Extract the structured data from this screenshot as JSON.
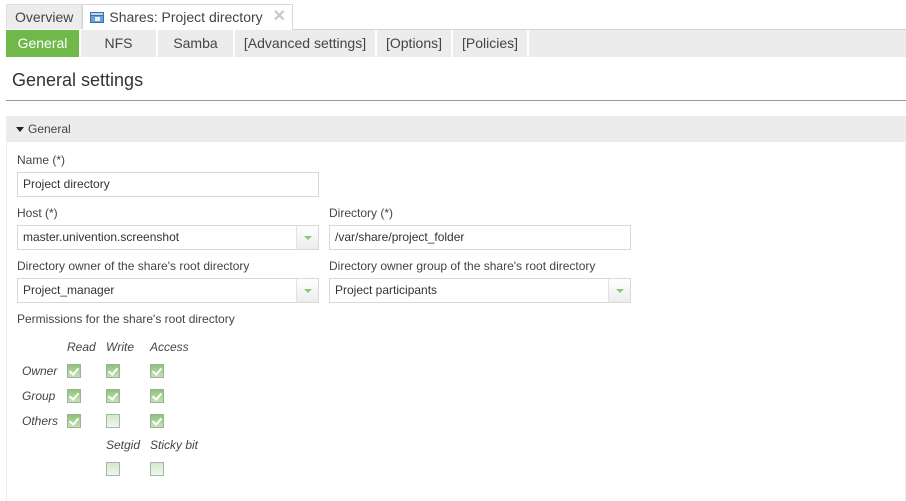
{
  "top_tabs": [
    {
      "label": "Overview",
      "active": false
    },
    {
      "label": "Shares: Project directory",
      "active": true,
      "icon": "share-icon",
      "closable": true
    }
  ],
  "sub_tabs": [
    {
      "label": "General",
      "active": true
    },
    {
      "label": "NFS",
      "active": false
    },
    {
      "label": "Samba",
      "active": false
    },
    {
      "label": "[Advanced settings]",
      "active": false
    },
    {
      "label": "[Options]",
      "active": false
    },
    {
      "label": "[Policies]",
      "active": false
    }
  ],
  "page_title": "General settings",
  "section": {
    "title": "General",
    "expanded": true
  },
  "form": {
    "name": {
      "label": "Name (*)",
      "value": "Project directory"
    },
    "host": {
      "label": "Host (*)",
      "value": "master.univention.screenshot"
    },
    "directory": {
      "label": "Directory (*)",
      "value": "/var/share/project_folder"
    },
    "owner": {
      "label": "Directory owner of the share's root directory",
      "value": "Project_manager"
    },
    "group": {
      "label": "Directory owner group of the share's root directory",
      "value": "Project participants"
    },
    "permissions": {
      "label": "Permissions for the share's root directory",
      "columns": [
        "Read",
        "Write",
        "Access"
      ],
      "rows": [
        {
          "label": "Owner",
          "read": true,
          "write": true,
          "access": true
        },
        {
          "label": "Group",
          "read": true,
          "write": true,
          "access": true
        },
        {
          "label": "Others",
          "read": true,
          "write": false,
          "access": true
        }
      ],
      "special": [
        {
          "label": "Setgid",
          "checked": false
        },
        {
          "label": "Sticky bit",
          "checked": false
        }
      ]
    }
  },
  "colors": {
    "accent": "#71b84b",
    "tab_bg": "#ececec"
  }
}
